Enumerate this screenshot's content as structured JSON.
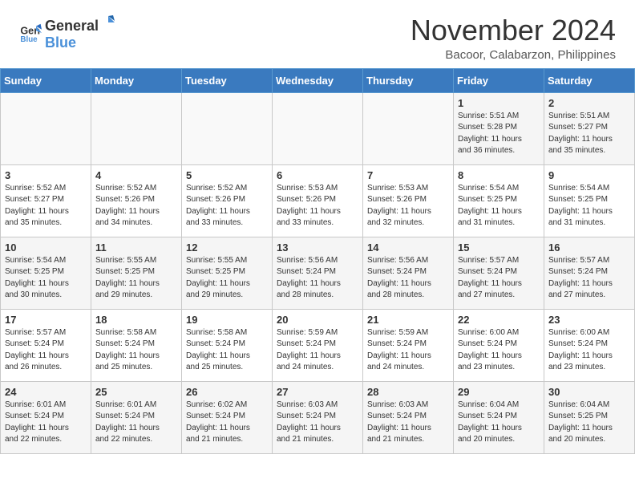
{
  "header": {
    "logo_general": "General",
    "logo_blue": "Blue",
    "month_title": "November 2024",
    "location": "Bacoor, Calabarzon, Philippines"
  },
  "days_of_week": [
    "Sunday",
    "Monday",
    "Tuesday",
    "Wednesday",
    "Thursday",
    "Friday",
    "Saturday"
  ],
  "weeks": [
    [
      {
        "day": "",
        "info": ""
      },
      {
        "day": "",
        "info": ""
      },
      {
        "day": "",
        "info": ""
      },
      {
        "day": "",
        "info": ""
      },
      {
        "day": "",
        "info": ""
      },
      {
        "day": "1",
        "info": "Sunrise: 5:51 AM\nSunset: 5:28 PM\nDaylight: 11 hours\nand 36 minutes."
      },
      {
        "day": "2",
        "info": "Sunrise: 5:51 AM\nSunset: 5:27 PM\nDaylight: 11 hours\nand 35 minutes."
      }
    ],
    [
      {
        "day": "3",
        "info": "Sunrise: 5:52 AM\nSunset: 5:27 PM\nDaylight: 11 hours\nand 35 minutes."
      },
      {
        "day": "4",
        "info": "Sunrise: 5:52 AM\nSunset: 5:26 PM\nDaylight: 11 hours\nand 34 minutes."
      },
      {
        "day": "5",
        "info": "Sunrise: 5:52 AM\nSunset: 5:26 PM\nDaylight: 11 hours\nand 33 minutes."
      },
      {
        "day": "6",
        "info": "Sunrise: 5:53 AM\nSunset: 5:26 PM\nDaylight: 11 hours\nand 33 minutes."
      },
      {
        "day": "7",
        "info": "Sunrise: 5:53 AM\nSunset: 5:26 PM\nDaylight: 11 hours\nand 32 minutes."
      },
      {
        "day": "8",
        "info": "Sunrise: 5:54 AM\nSunset: 5:25 PM\nDaylight: 11 hours\nand 31 minutes."
      },
      {
        "day": "9",
        "info": "Sunrise: 5:54 AM\nSunset: 5:25 PM\nDaylight: 11 hours\nand 31 minutes."
      }
    ],
    [
      {
        "day": "10",
        "info": "Sunrise: 5:54 AM\nSunset: 5:25 PM\nDaylight: 11 hours\nand 30 minutes."
      },
      {
        "day": "11",
        "info": "Sunrise: 5:55 AM\nSunset: 5:25 PM\nDaylight: 11 hours\nand 29 minutes."
      },
      {
        "day": "12",
        "info": "Sunrise: 5:55 AM\nSunset: 5:25 PM\nDaylight: 11 hours\nand 29 minutes."
      },
      {
        "day": "13",
        "info": "Sunrise: 5:56 AM\nSunset: 5:24 PM\nDaylight: 11 hours\nand 28 minutes."
      },
      {
        "day": "14",
        "info": "Sunrise: 5:56 AM\nSunset: 5:24 PM\nDaylight: 11 hours\nand 28 minutes."
      },
      {
        "day": "15",
        "info": "Sunrise: 5:57 AM\nSunset: 5:24 PM\nDaylight: 11 hours\nand 27 minutes."
      },
      {
        "day": "16",
        "info": "Sunrise: 5:57 AM\nSunset: 5:24 PM\nDaylight: 11 hours\nand 27 minutes."
      }
    ],
    [
      {
        "day": "17",
        "info": "Sunrise: 5:57 AM\nSunset: 5:24 PM\nDaylight: 11 hours\nand 26 minutes."
      },
      {
        "day": "18",
        "info": "Sunrise: 5:58 AM\nSunset: 5:24 PM\nDaylight: 11 hours\nand 25 minutes."
      },
      {
        "day": "19",
        "info": "Sunrise: 5:58 AM\nSunset: 5:24 PM\nDaylight: 11 hours\nand 25 minutes."
      },
      {
        "day": "20",
        "info": "Sunrise: 5:59 AM\nSunset: 5:24 PM\nDaylight: 11 hours\nand 24 minutes."
      },
      {
        "day": "21",
        "info": "Sunrise: 5:59 AM\nSunset: 5:24 PM\nDaylight: 11 hours\nand 24 minutes."
      },
      {
        "day": "22",
        "info": "Sunrise: 6:00 AM\nSunset: 5:24 PM\nDaylight: 11 hours\nand 23 minutes."
      },
      {
        "day": "23",
        "info": "Sunrise: 6:00 AM\nSunset: 5:24 PM\nDaylight: 11 hours\nand 23 minutes."
      }
    ],
    [
      {
        "day": "24",
        "info": "Sunrise: 6:01 AM\nSunset: 5:24 PM\nDaylight: 11 hours\nand 22 minutes."
      },
      {
        "day": "25",
        "info": "Sunrise: 6:01 AM\nSunset: 5:24 PM\nDaylight: 11 hours\nand 22 minutes."
      },
      {
        "day": "26",
        "info": "Sunrise: 6:02 AM\nSunset: 5:24 PM\nDaylight: 11 hours\nand 21 minutes."
      },
      {
        "day": "27",
        "info": "Sunrise: 6:03 AM\nSunset: 5:24 PM\nDaylight: 11 hours\nand 21 minutes."
      },
      {
        "day": "28",
        "info": "Sunrise: 6:03 AM\nSunset: 5:24 PM\nDaylight: 11 hours\nand 21 minutes."
      },
      {
        "day": "29",
        "info": "Sunrise: 6:04 AM\nSunset: 5:24 PM\nDaylight: 11 hours\nand 20 minutes."
      },
      {
        "day": "30",
        "info": "Sunrise: 6:04 AM\nSunset: 5:25 PM\nDaylight: 11 hours\nand 20 minutes."
      }
    ]
  ]
}
